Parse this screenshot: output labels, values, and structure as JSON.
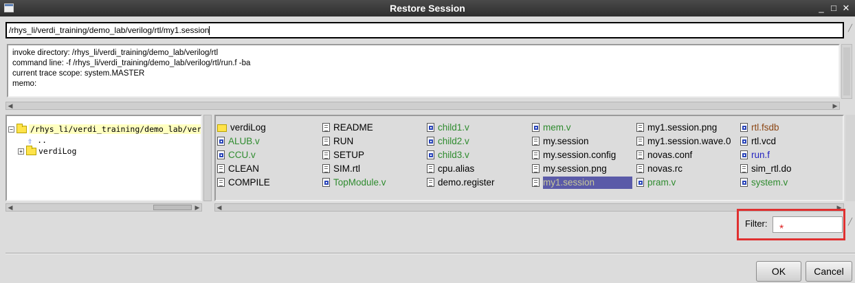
{
  "window": {
    "title": "Restore Session",
    "minimize": "_",
    "maximize": "□",
    "close": "✕"
  },
  "path_field": {
    "value": "/rhys_li/verdi_training/demo_lab/verilog/rtl/my1.session"
  },
  "info": {
    "lines": [
      "invoke directory: /rhys_li/verdi_training/demo_lab/verilog/rtl",
      "command line: -f /rhys_li/verdi_training/demo_lab/verilog/rtl/run.f -ba",
      "current trace scope: system.MASTER",
      "memo:"
    ]
  },
  "tree": {
    "root": "/rhys_li/verdi_training/demo_lab/verilog/rtl",
    "parent": "..",
    "child": "verdiLog",
    "root_expander": "−",
    "child_expander": "+"
  },
  "files": {
    "columns": [
      [
        {
          "name": "verdiLog",
          "icon": "folder",
          "color": "black"
        },
        {
          "name": "ALUB.v",
          "icon": "verilog",
          "color": "green"
        },
        {
          "name": "CCU.v",
          "icon": "verilog",
          "color": "green"
        },
        {
          "name": "CLEAN",
          "icon": "doc",
          "color": "black"
        },
        {
          "name": "COMPILE",
          "icon": "doc",
          "color": "black"
        }
      ],
      [
        {
          "name": "README",
          "icon": "doc",
          "color": "black"
        },
        {
          "name": "RUN",
          "icon": "doc",
          "color": "black"
        },
        {
          "name": "SETUP",
          "icon": "doc",
          "color": "black"
        },
        {
          "name": "SIM.rtl",
          "icon": "doc",
          "color": "black"
        },
        {
          "name": "TopModule.v",
          "icon": "verilog",
          "color": "green"
        }
      ],
      [
        {
          "name": "child1.v",
          "icon": "verilog",
          "color": "green"
        },
        {
          "name": "child2.v",
          "icon": "verilog",
          "color": "green"
        },
        {
          "name": "child3.v",
          "icon": "verilog",
          "color": "green"
        },
        {
          "name": "cpu.alias",
          "icon": "doc",
          "color": "black"
        },
        {
          "name": "demo.register",
          "icon": "doc",
          "color": "black"
        }
      ],
      [
        {
          "name": "mem.v",
          "icon": "verilog",
          "color": "green"
        },
        {
          "name": "my.session",
          "icon": "doc",
          "color": "black"
        },
        {
          "name": "my.session.config",
          "icon": "doc",
          "color": "black"
        },
        {
          "name": "my.session.png",
          "icon": "doc",
          "color": "black"
        },
        {
          "name": "my1.session",
          "icon": "doc",
          "color": "black",
          "selected": true
        }
      ],
      [
        {
          "name": "my1.session.png",
          "icon": "doc",
          "color": "black"
        },
        {
          "name": "my1.session.wave.0",
          "icon": "doc",
          "color": "black"
        },
        {
          "name": "novas.conf",
          "icon": "doc",
          "color": "black"
        },
        {
          "name": "novas.rc",
          "icon": "doc",
          "color": "black"
        },
        {
          "name": "pram.v",
          "icon": "verilog",
          "color": "green"
        }
      ],
      [
        {
          "name": "rtl.fsdb",
          "icon": "verilog",
          "color": "brown"
        },
        {
          "name": "rtl.vcd",
          "icon": "verilog",
          "color": "black"
        },
        {
          "name": "run.f",
          "icon": "verilog",
          "color": "blue"
        },
        {
          "name": "sim_rtl.do",
          "icon": "doc",
          "color": "black"
        },
        {
          "name": "system.v",
          "icon": "verilog",
          "color": "green"
        }
      ]
    ]
  },
  "filter": {
    "label": "Filter:",
    "value": "*"
  },
  "buttons": {
    "ok": "OK",
    "cancel": "Cancel"
  },
  "colors": {
    "selection_bg": "#5a5aa8",
    "highlight_border": "#e03030",
    "verilog_file": "#2e8b2e"
  }
}
